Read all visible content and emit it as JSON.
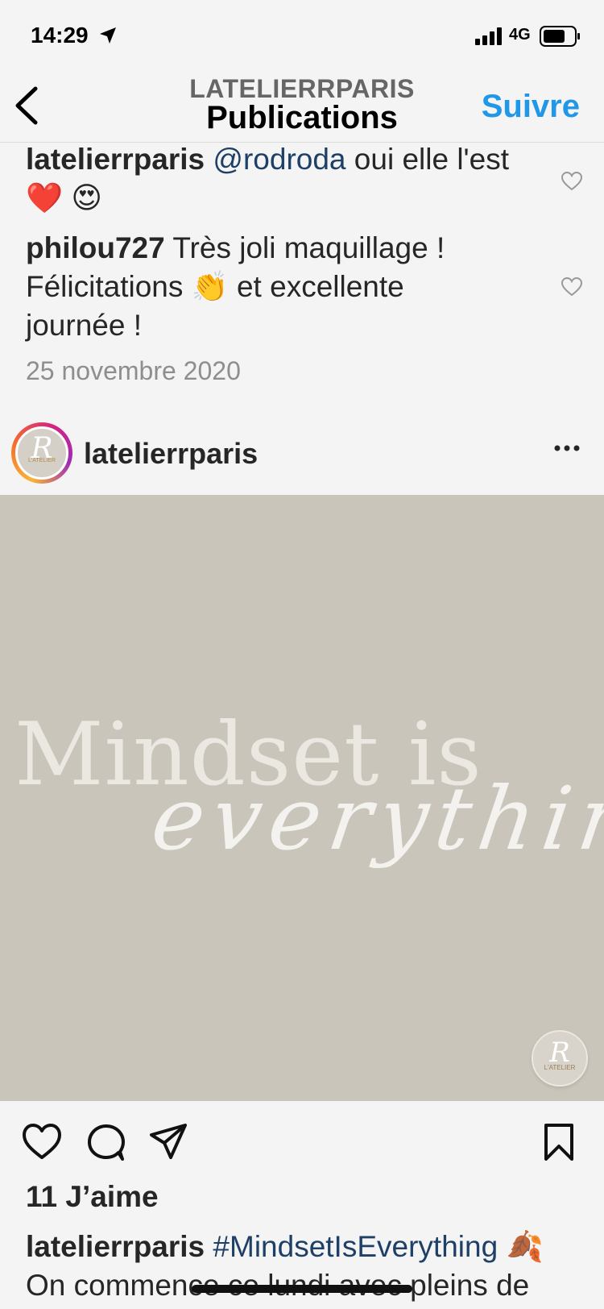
{
  "status": {
    "time": "14:29",
    "network": "4G"
  },
  "nav": {
    "username": "LATELIERRPARIS",
    "title": "Publications",
    "follow_label": "Suivre"
  },
  "comments": [
    {
      "user": "latelierrparis",
      "mention": "@rodroda",
      "text": " oui elle l'est",
      "emoji": "❤️ 😍"
    },
    {
      "user": "philou727",
      "text_line1": " Très joli maquillage !",
      "text_line2": "Félicitations 👏 et excellente",
      "text_line3": "journée !"
    }
  ],
  "date": "25 novembre 2020",
  "post": {
    "user": "latelierrparis",
    "avatar_letter": "R",
    "avatar_text": "L'ATELIER",
    "image_line1": "Mindset is",
    "image_line2": "everything",
    "watermark_letter": "R",
    "watermark_text": "L'ATELIER",
    "likes": "11 J’aime",
    "caption_user": "latelierrparis",
    "caption_tag": "#MindsetIsEverything",
    "caption_emoji": "🍂",
    "caption_line2": "On commence ce lundi avec pleins de"
  },
  "icons": {
    "location": "location-arrow-icon",
    "signal": "signal-icon",
    "battery": "battery-icon",
    "back": "chevron-left-icon",
    "like": "heart-icon",
    "comment": "comment-icon",
    "share": "paper-plane-icon",
    "save": "bookmark-icon",
    "more": "more-icon"
  },
  "colors": {
    "accent": "#2197e8",
    "mention": "#1e3f66",
    "image_bg": "#c9c5bb"
  }
}
